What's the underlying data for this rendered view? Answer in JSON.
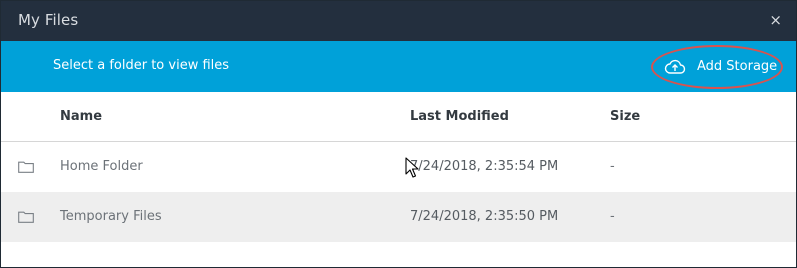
{
  "window": {
    "title": "My Files",
    "close_glyph": "×"
  },
  "banner": {
    "text": "Select a folder to view files",
    "add_storage_label": "Add Storage",
    "add_storage_icon": "cloud-upload-icon",
    "color": "#00a1d9"
  },
  "table": {
    "columns": [
      "Name",
      "Last Modified",
      "Size"
    ],
    "rows": [
      {
        "icon": "folder-icon",
        "name": "Home Folder",
        "modified": "7/24/2018, 2:35:54 PM",
        "size": "-"
      },
      {
        "icon": "folder-icon",
        "name": "Temporary Files",
        "modified": "7/24/2018, 2:35:50 PM",
        "size": "-"
      }
    ]
  },
  "colors": {
    "titlebar": "#232f3e",
    "highlight": "#d9534f"
  }
}
